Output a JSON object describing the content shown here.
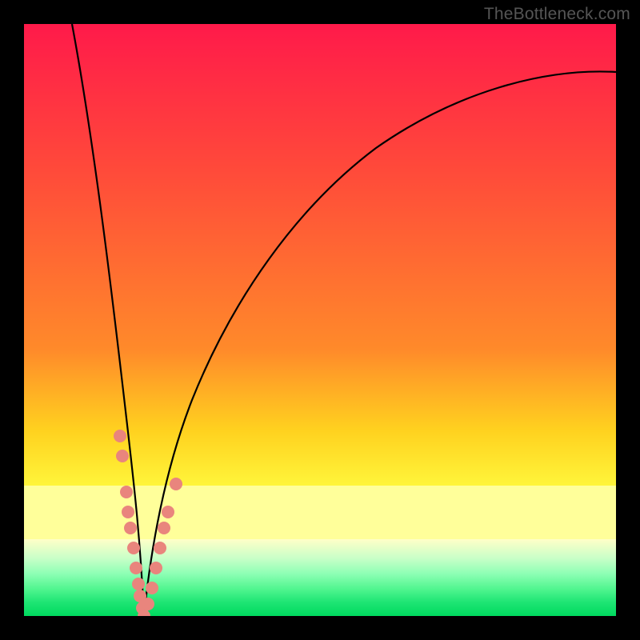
{
  "watermark": "TheBottleneck.com",
  "chart_data": {
    "type": "line",
    "title": "",
    "xlabel": "",
    "ylabel": "",
    "xlim": [
      0,
      100
    ],
    "ylim": [
      0,
      100
    ],
    "grid": false,
    "legend": false,
    "background_gradient": [
      "#ff1a4a",
      "#ff6a2a",
      "#ffd21f",
      "#ffff70",
      "#8dffb4",
      "#00d95e"
    ],
    "series": [
      {
        "name": "left-curve",
        "color": "#000000",
        "x": [
          8.1,
          9.5,
          10.8,
          12.2,
          13.5,
          14.9,
          16.2,
          17.0,
          17.6,
          18.2,
          18.9,
          19.5,
          19.9,
          20.3
        ],
        "y": [
          100.0,
          89.2,
          78.4,
          66.2,
          55.4,
          43.2,
          31.1,
          23.6,
          18.2,
          12.8,
          8.1,
          4.1,
          2.0,
          0.0
        ]
      },
      {
        "name": "right-curve",
        "color": "#000000",
        "x": [
          20.3,
          21.6,
          23.0,
          24.3,
          25.7,
          28.4,
          31.1,
          33.8,
          37.8,
          43.2,
          50.0,
          58.1,
          67.6,
          78.4,
          89.2,
          100.0
        ],
        "y": [
          0.0,
          4.1,
          10.1,
          16.2,
          22.3,
          31.8,
          40.5,
          47.3,
          55.4,
          63.5,
          70.9,
          77.7,
          83.1,
          87.2,
          89.9,
          91.9
        ]
      },
      {
        "name": "left-dots",
        "color": "#e9857d",
        "type": "scatter",
        "x": [
          16.2,
          16.6,
          17.3,
          17.6,
          18.0,
          18.5,
          18.9,
          19.3,
          19.6,
          20.0,
          20.3
        ],
        "y": [
          30.4,
          27.0,
          20.9,
          17.6,
          14.9,
          11.5,
          8.1,
          5.4,
          3.4,
          1.4,
          0.0
        ]
      },
      {
        "name": "right-dots",
        "color": "#e9857d",
        "type": "scatter",
        "x": [
          20.9,
          21.6,
          22.3,
          23.0,
          23.6,
          24.3,
          25.7
        ],
        "y": [
          2.0,
          4.7,
          8.1,
          11.5,
          14.9,
          17.6,
          22.3
        ]
      }
    ]
  }
}
